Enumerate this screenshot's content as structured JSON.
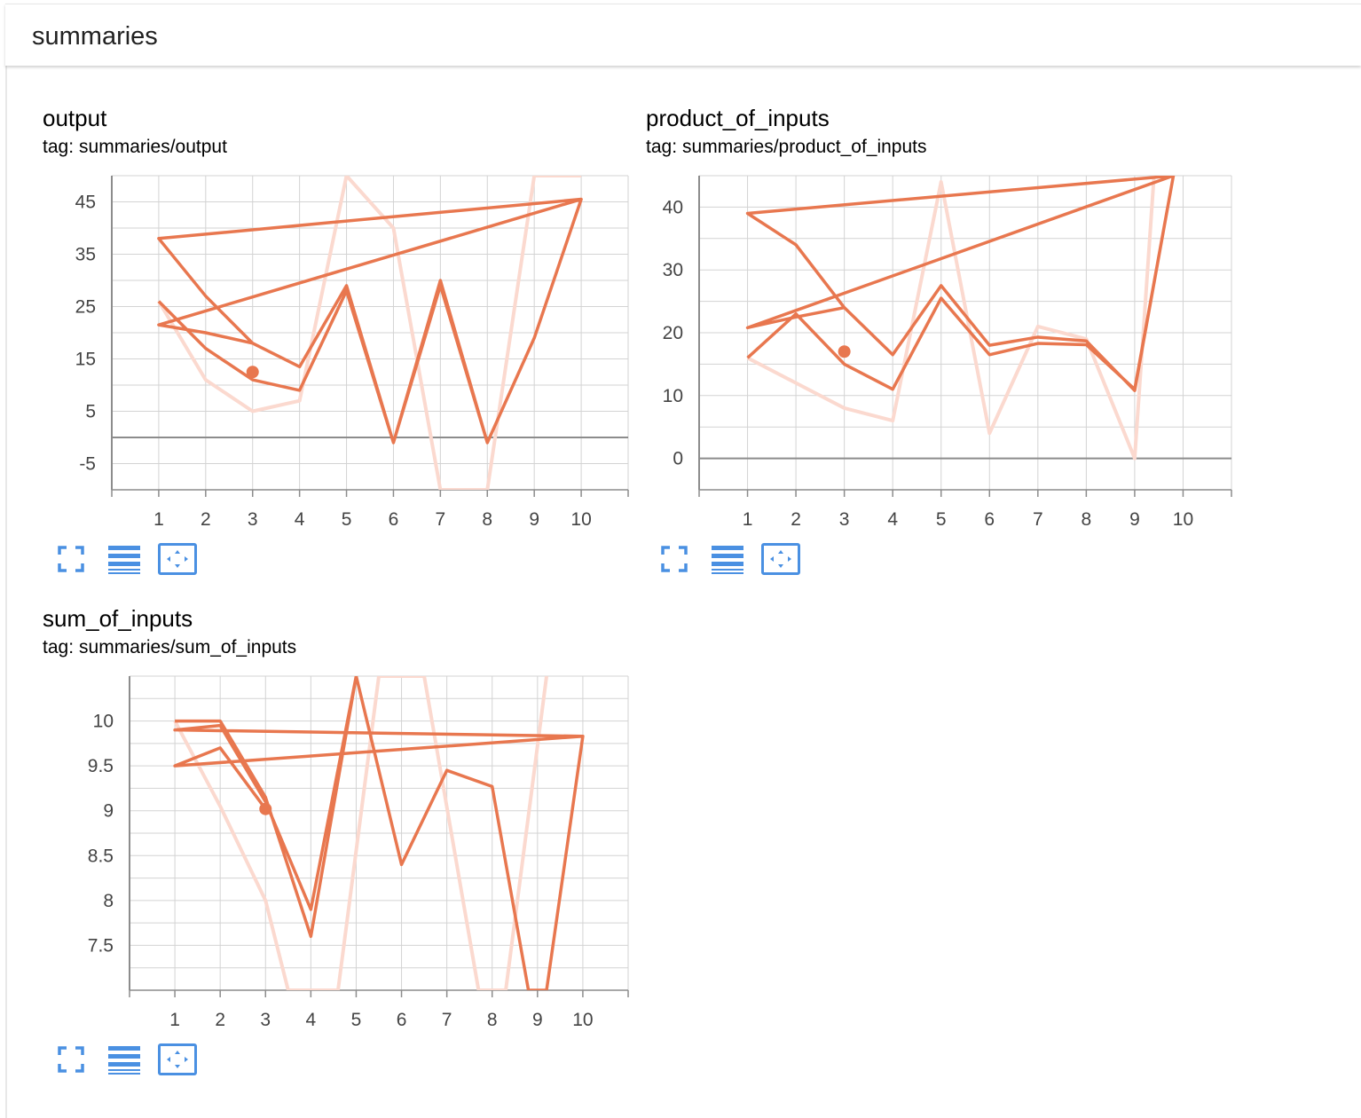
{
  "header": {
    "title": "summaries"
  },
  "icons": {
    "fullscreen": "fullscreen-icon",
    "data_selection": "data-selection-icon",
    "fit_domain": "fit-domain-icon"
  },
  "colors": {
    "series": "#e8774f",
    "smoothed_raw": "#fbd9cf",
    "grid": "#d3d3d3",
    "axis": "#8c8c8c",
    "button": "#4a90e2"
  },
  "charts": [
    {
      "title": "output",
      "tag_prefix": "tag:",
      "tag": "summaries/output",
      "chart_data": {
        "type": "line",
        "title": "output",
        "xlabel": "",
        "ylabel": "",
        "xlim": [
          0,
          11
        ],
        "ylim": [
          -10,
          50
        ],
        "x_ticks": [
          1,
          2,
          3,
          4,
          5,
          6,
          7,
          8,
          9,
          10
        ],
        "y_ticks": [
          -5,
          5,
          15,
          25,
          35,
          45
        ],
        "grid": true,
        "highlight_point": {
          "x": 3,
          "y": 12.5
        },
        "series": [
          {
            "values": [
              [
                1,
                26
              ],
              [
                2,
                17
              ],
              [
                3,
                11
              ],
              [
                4,
                9
              ],
              [
                5,
                28
              ],
              [
                6,
                -1
              ],
              [
                7,
                30
              ],
              [
                8,
                -1
              ],
              [
                9,
                19
              ],
              [
                10,
                45.5
              ],
              [
                1,
                38
              ],
              [
                2,
                27
              ],
              [
                3,
                18
              ],
              [
                4,
                13.5
              ],
              [
                5,
                29
              ],
              [
                6,
                -1
              ],
              [
                7,
                29
              ],
              [
                8,
                -1
              ],
              [
                9,
                19
              ],
              [
                10,
                45.5
              ],
              [
                1,
                21.5
              ],
              [
                2,
                20
              ],
              [
                3,
                18
              ]
            ],
            "raw": [
              [
                1,
                26
              ],
              [
                2,
                11
              ],
              [
                3,
                5
              ],
              [
                4,
                7
              ],
              [
                5,
                50
              ],
              [
                6,
                40
              ],
              [
                7,
                -10
              ],
              [
                8,
                -10
              ],
              [
                9,
                50
              ],
              [
                10,
                50
              ]
            ]
          }
        ]
      }
    },
    {
      "title": "product_of_inputs",
      "tag_prefix": "tag:",
      "tag": "summaries/product_of_inputs",
      "chart_data": {
        "type": "line",
        "title": "product_of_inputs",
        "xlabel": "",
        "ylabel": "",
        "xlim": [
          0,
          11
        ],
        "ylim": [
          -5,
          45
        ],
        "x_ticks": [
          1,
          2,
          3,
          4,
          5,
          6,
          7,
          8,
          9,
          10
        ],
        "y_ticks": [
          0,
          10,
          20,
          30,
          40
        ],
        "grid": true,
        "highlight_point": {
          "x": 3,
          "y": 17
        },
        "series": [
          {
            "values": [
              [
                1,
                16
              ],
              [
                2,
                23
              ],
              [
                3,
                15
              ],
              [
                4,
                11
              ],
              [
                5,
                25.5
              ],
              [
                6,
                16.5
              ],
              [
                7,
                18.3
              ],
              [
                8,
                18.1
              ],
              [
                9,
                11
              ],
              [
                9.8,
                45
              ],
              [
                1,
                39
              ],
              [
                2,
                34
              ],
              [
                3,
                24
              ],
              [
                4,
                16.5
              ],
              [
                5,
                27.5
              ],
              [
                6,
                18
              ],
              [
                7,
                19.3
              ],
              [
                8,
                18.7
              ],
              [
                9,
                10.8
              ],
              [
                9.8,
                45
              ],
              [
                1,
                20.8
              ],
              [
                2,
                22.5
              ],
              [
                3,
                24
              ]
            ],
            "raw": [
              [
                1,
                16
              ],
              [
                2,
                12
              ],
              [
                3,
                8
              ],
              [
                4,
                6
              ],
              [
                5,
                44
              ],
              [
                6,
                4
              ],
              [
                7,
                21
              ],
              [
                8,
                19
              ],
              [
                9,
                0
              ],
              [
                9.4,
                45
              ]
            ]
          }
        ]
      }
    },
    {
      "title": "sum_of_inputs",
      "tag_prefix": "tag:",
      "tag": "summaries/sum_of_inputs",
      "chart_data": {
        "type": "line",
        "title": "sum_of_inputs",
        "xlabel": "",
        "ylabel": "",
        "xlim": [
          0,
          11
        ],
        "ylim": [
          7,
          10.5
        ],
        "x_ticks": [
          1,
          2,
          3,
          4,
          5,
          6,
          7,
          8,
          9,
          10
        ],
        "y_ticks": [
          7.5,
          8,
          8.5,
          9,
          9.5,
          10
        ],
        "grid": true,
        "highlight_point": {
          "x": 3,
          "y": 9.02
        },
        "series": [
          {
            "values": [
              [
                1,
                10
              ],
              [
                2,
                10
              ],
              [
                3,
                9.15
              ],
              [
                4,
                7.6
              ],
              [
                5,
                10.5
              ],
              [
                6,
                8.4
              ],
              [
                7,
                9.45
              ],
              [
                8,
                9.27
              ],
              [
                8.8,
                7
              ],
              [
                9.2,
                7
              ],
              [
                10,
                9.83
              ],
              [
                1,
                9.9
              ],
              [
                2,
                9.95
              ],
              [
                3,
                9.1
              ],
              [
                4,
                7.9
              ],
              [
                5,
                10.5
              ],
              [
                6,
                8.4
              ],
              [
                7,
                9.45
              ],
              [
                8,
                9.27
              ],
              [
                8.8,
                7
              ],
              [
                9.2,
                7
              ],
              [
                10,
                9.83
              ],
              [
                1,
                9.5
              ],
              [
                2,
                9.7
              ],
              [
                3,
                9.02
              ]
            ],
            "raw": [
              [
                1,
                10
              ],
              [
                2,
                9.05
              ],
              [
                3,
                8
              ],
              [
                3.5,
                7
              ],
              [
                4.6,
                7
              ],
              [
                5.5,
                10.5
              ],
              [
                6.5,
                10.5
              ],
              [
                7.7,
                7
              ],
              [
                8.3,
                7
              ],
              [
                9.2,
                10.5
              ]
            ]
          }
        ]
      }
    }
  ]
}
